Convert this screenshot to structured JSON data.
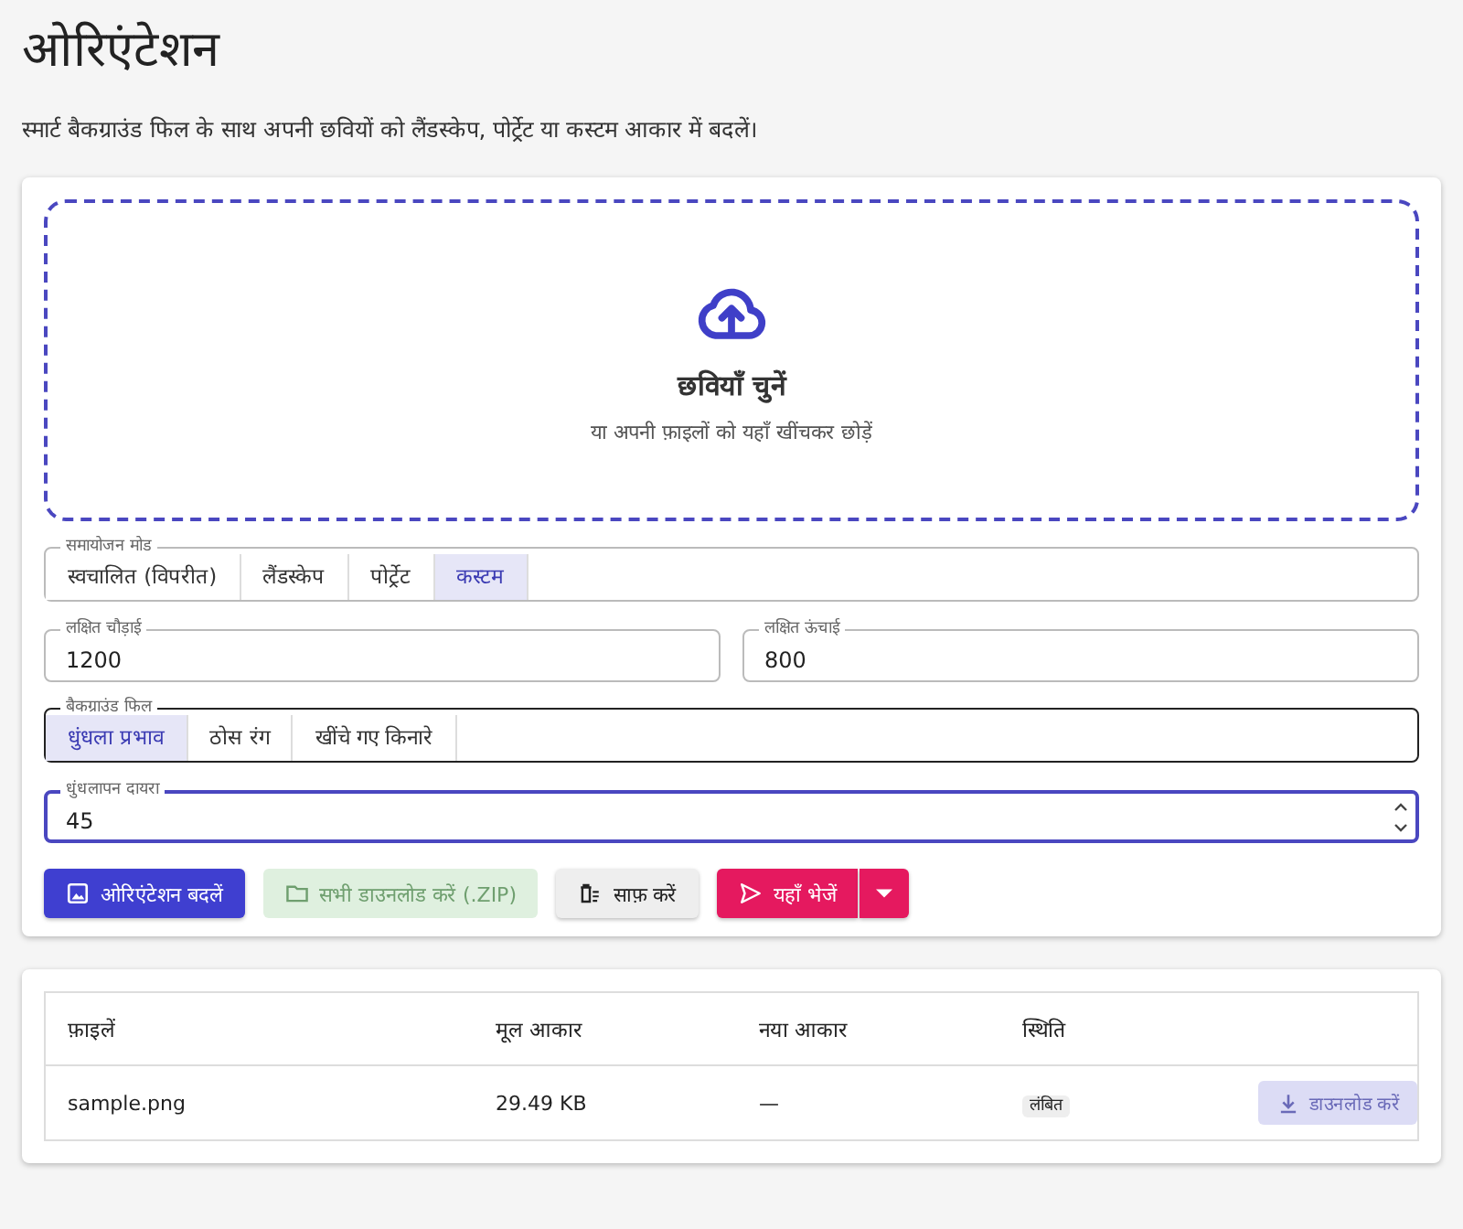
{
  "page": {
    "title": "ओरिएंटेशन",
    "subtitle": "स्मार्ट बैकग्राउंड फिल के साथ अपनी छवियों को लैंडस्केप, पोर्ट्रेट या कस्टम आकार में बदलें।"
  },
  "dropzone": {
    "title": "छवियाँ चुनें",
    "hint": "या अपनी फ़ाइलों को यहाँ खींचकर छोड़ें"
  },
  "mode": {
    "label": "समायोजन मोड",
    "options": [
      {
        "label": "स्वचालित (विपरीत)",
        "selected": false
      },
      {
        "label": "लैंडस्केप",
        "selected": false
      },
      {
        "label": "पोर्ट्रेट",
        "selected": false
      },
      {
        "label": "कस्टम",
        "selected": true
      }
    ]
  },
  "width": {
    "label": "लक्षित चौड़ाई",
    "value": "1200"
  },
  "height": {
    "label": "लक्षित ऊंचाई",
    "value": "800"
  },
  "fill": {
    "label": "बैकग्राउंड फिल",
    "options": [
      {
        "label": "धुंधला प्रभाव",
        "selected": true
      },
      {
        "label": "ठोस रंग",
        "selected": false
      },
      {
        "label": "खींचे गए किनारे",
        "selected": false
      }
    ]
  },
  "blur": {
    "label": "धुंधलापन दायरा",
    "value": "45",
    "focused": true
  },
  "actions": [
    {
      "kind": "primary",
      "label": "ओरिएंटेशन बदलें",
      "disabled": false
    },
    {
      "kind": "zip",
      "label": "सभी डाउनलोड करें (.ZIP)",
      "disabled": true
    },
    {
      "kind": "clear",
      "label": "साफ़ करें",
      "disabled": false
    },
    {
      "kind": "send",
      "label": "यहाँ भेजें",
      "disabled": false
    }
  ],
  "table": {
    "columns": [
      "फ़ाइलें",
      "मूल आकार",
      "नया आकार",
      "स्थिति"
    ],
    "rows": [
      {
        "file": "sample.png",
        "original": "29.49 KB",
        "new": "—",
        "status": "लंबित",
        "download": {
          "label": "डाउनलोड करें",
          "disabled": true
        }
      }
    ]
  }
}
